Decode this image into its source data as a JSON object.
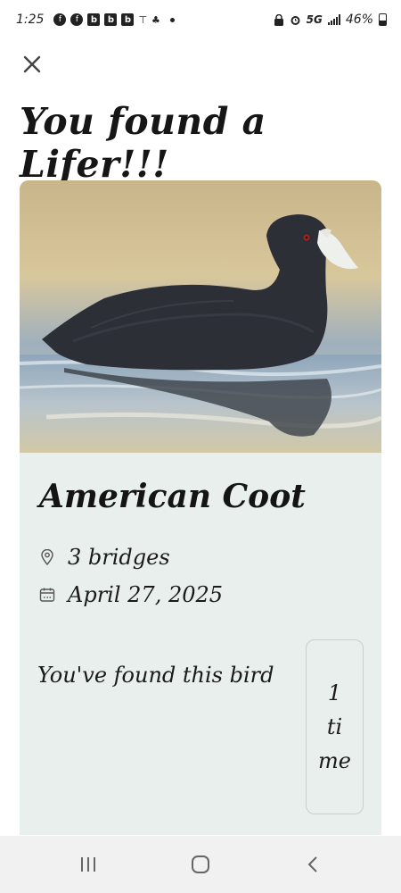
{
  "status_bar": {
    "time": "1:25",
    "network": "5G",
    "battery_percent": "46%"
  },
  "header": {
    "close_icon": "close-icon",
    "title": "You found a Lifer!!!"
  },
  "bird": {
    "name": "American Coot",
    "location": "3 bridges",
    "date": "April 27, 2025",
    "found_text": "You've found this bird",
    "found_count": "1",
    "found_unit_parts": [
      "ti",
      "me"
    ]
  },
  "nav": {
    "recents_icon": "recents-icon",
    "home_icon": "home-icon",
    "back_icon": "back-icon"
  },
  "colors": {
    "card_background": "#e9efed",
    "nav_background": "#f1f1f1",
    "text": "#1a1a1a"
  }
}
